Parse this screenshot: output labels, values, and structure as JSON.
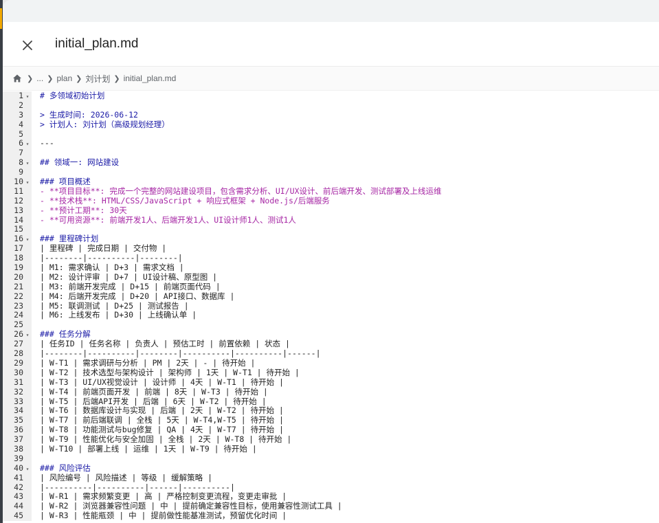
{
  "window": {
    "title": "initial_plan.md"
  },
  "breadcrumb": [
    "...",
    "plan",
    "刘计划",
    "initial_plan.md"
  ],
  "lines": [
    {
      "n": "1",
      "fold": true,
      "kind": "h",
      "text": "# 多领域初始计划"
    },
    {
      "n": "2",
      "fold": false,
      "kind": "t",
      "text": ""
    },
    {
      "n": "3",
      "fold": false,
      "kind": "q",
      "text": "> 生成时间: 2026-06-12"
    },
    {
      "n": "4",
      "fold": false,
      "kind": "q",
      "text": "> 计划人: 刘计划（高级规划经理）"
    },
    {
      "n": "5",
      "fold": false,
      "kind": "t",
      "text": ""
    },
    {
      "n": "6",
      "fold": true,
      "kind": "hr",
      "text": "---"
    },
    {
      "n": "7",
      "fold": false,
      "kind": "t",
      "text": ""
    },
    {
      "n": "8",
      "fold": true,
      "kind": "h",
      "text": "## 领域一: 网站建设"
    },
    {
      "n": "9",
      "fold": false,
      "kind": "t",
      "text": ""
    },
    {
      "n": "10",
      "fold": true,
      "kind": "h",
      "text": "### 项目概述"
    },
    {
      "n": "11",
      "fold": false,
      "kind": "li",
      "text": "- **项目目标**: 完成一个完整的网站建设项目，包含需求分析、UI/UX设计、前后端开发、测试部署及上线运维"
    },
    {
      "n": "12",
      "fold": false,
      "kind": "li",
      "text": "- **技术栈**: HTML/CSS/JavaScript + 响应式框架 + Node.js/后端服务"
    },
    {
      "n": "13",
      "fold": false,
      "kind": "li",
      "text": "- **预计工期**: 30天"
    },
    {
      "n": "14",
      "fold": false,
      "kind": "li",
      "text": "- **可用资源**: 前端开发1人、后端开发1人、UI设计师1人、测试1人"
    },
    {
      "n": "15",
      "fold": false,
      "kind": "t",
      "text": ""
    },
    {
      "n": "16",
      "fold": true,
      "kind": "h",
      "text": "### 里程碑计划"
    },
    {
      "n": "17",
      "fold": false,
      "kind": "t",
      "text": "| 里程碑 | 完成日期 | 交付物 |"
    },
    {
      "n": "18",
      "fold": false,
      "kind": "t",
      "text": "|--------|----------|--------|"
    },
    {
      "n": "19",
      "fold": false,
      "kind": "t",
      "text": "| M1: 需求确认 | D+3 | 需求文档 |"
    },
    {
      "n": "20",
      "fold": false,
      "kind": "t",
      "text": "| M2: 设计评审 | D+7 | UI设计稿、原型图 |"
    },
    {
      "n": "21",
      "fold": false,
      "kind": "t",
      "text": "| M3: 前端开发完成 | D+15 | 前端页面代码 |"
    },
    {
      "n": "22",
      "fold": false,
      "kind": "t",
      "text": "| M4: 后端开发完成 | D+20 | API接口、数据库 |"
    },
    {
      "n": "23",
      "fold": false,
      "kind": "t",
      "text": "| M5: 联调测试 | D+25 | 测试报告 |"
    },
    {
      "n": "24",
      "fold": false,
      "kind": "t",
      "text": "| M6: 上线发布 | D+30 | 上线确认单 |"
    },
    {
      "n": "25",
      "fold": false,
      "kind": "t",
      "text": ""
    },
    {
      "n": "26",
      "fold": true,
      "kind": "h",
      "text": "### 任务分解"
    },
    {
      "n": "27",
      "fold": false,
      "kind": "t",
      "text": "| 任务ID | 任务名称 | 负责人 | 预估工时 | 前置依赖 | 状态 |"
    },
    {
      "n": "28",
      "fold": false,
      "kind": "t",
      "text": "|--------|----------|--------|----------|----------|------|"
    },
    {
      "n": "29",
      "fold": false,
      "kind": "t",
      "text": "| W-T1 | 需求调研与分析 | PM | 2天 | - | 待开始 |"
    },
    {
      "n": "30",
      "fold": false,
      "kind": "t",
      "text": "| W-T2 | 技术选型与架构设计 | 架构师 | 1天 | W-T1 | 待开始 |"
    },
    {
      "n": "31",
      "fold": false,
      "kind": "t",
      "text": "| W-T3 | UI/UX视觉设计 | 设计师 | 4天 | W-T1 | 待开始 |"
    },
    {
      "n": "32",
      "fold": false,
      "kind": "t",
      "text": "| W-T4 | 前端页面开发 | 前端 | 8天 | W-T3 | 待开始 |"
    },
    {
      "n": "33",
      "fold": false,
      "kind": "t",
      "text": "| W-T5 | 后端API开发 | 后端 | 6天 | W-T2 | 待开始 |"
    },
    {
      "n": "34",
      "fold": false,
      "kind": "t",
      "text": "| W-T6 | 数据库设计与实现 | 后端 | 2天 | W-T2 | 待开始 |"
    },
    {
      "n": "35",
      "fold": false,
      "kind": "t",
      "text": "| W-T7 | 前后端联调 | 全栈 | 5天 | W-T4,W-T5 | 待开始 |"
    },
    {
      "n": "36",
      "fold": false,
      "kind": "t",
      "text": "| W-T8 | 功能测试与bug修复 | QA | 4天 | W-T7 | 待开始 |"
    },
    {
      "n": "37",
      "fold": false,
      "kind": "t",
      "text": "| W-T9 | 性能优化与安全加固 | 全栈 | 2天 | W-T8 | 待开始 |"
    },
    {
      "n": "38",
      "fold": false,
      "kind": "t",
      "text": "| W-T10 | 部署上线 | 运维 | 1天 | W-T9 | 待开始 |"
    },
    {
      "n": "39",
      "fold": false,
      "kind": "t",
      "text": ""
    },
    {
      "n": "40",
      "fold": true,
      "kind": "h",
      "text": "### 风险评估"
    },
    {
      "n": "41",
      "fold": false,
      "kind": "t",
      "text": "| 风险编号 | 风险描述 | 等级 | 缓解策略 |"
    },
    {
      "n": "42",
      "fold": false,
      "kind": "t",
      "text": "|----------|----------|------|----------|"
    },
    {
      "n": "43",
      "fold": false,
      "kind": "t",
      "text": "| W-R1 | 需求频繁变更 | 高 | 严格控制变更流程，变更走审批 |"
    },
    {
      "n": "44",
      "fold": false,
      "kind": "t",
      "text": "| W-R2 | 浏览器兼容性问题 | 中 | 提前确定兼容性目标，使用兼容性测试工具 |"
    },
    {
      "n": "45",
      "fold": false,
      "kind": "t",
      "text": "| W-R3 | 性能瓶颈 | 中 | 提前做性能基准测试，预留优化时间 |"
    }
  ]
}
